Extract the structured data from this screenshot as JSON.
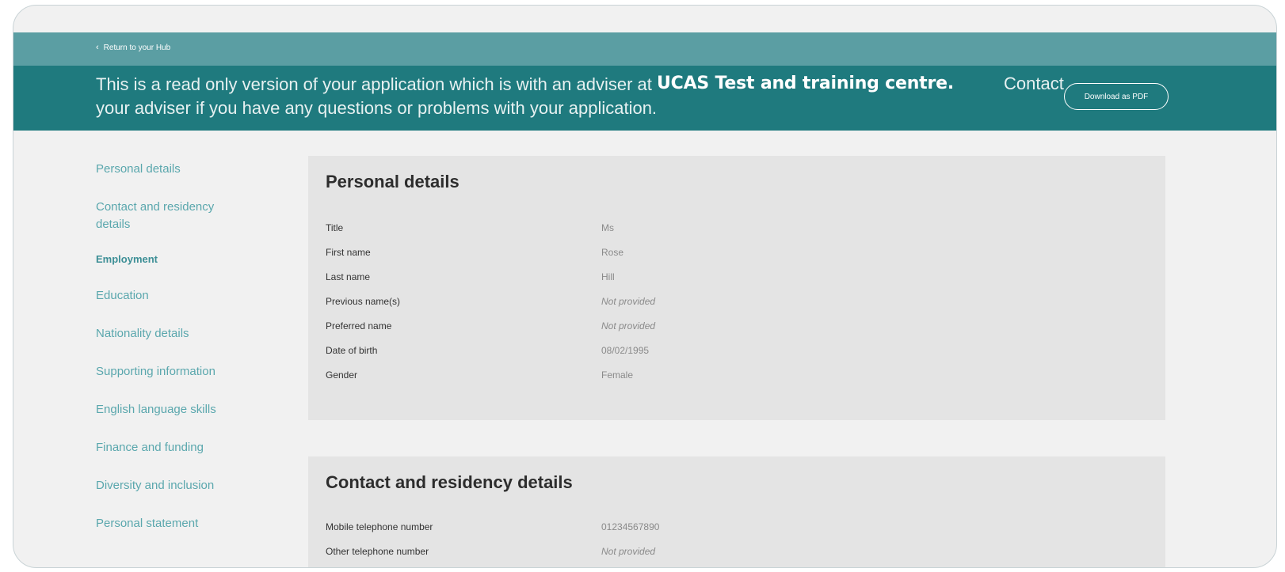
{
  "topbar": {
    "back_label": "Return to your Hub"
  },
  "banner": {
    "message_line1": "This is a read only version of your application which is with an adviser at",
    "message_line2": "your adviser if you have any questions or problems with your application.",
    "centre_name": "UCAS Test and training centre.",
    "contact_label": "Contact",
    "download_button": "Download as PDF"
  },
  "sidebar": {
    "items": [
      "Personal details",
      "Contact and residency details",
      "Employment",
      "Education",
      "Nationality details",
      "Supporting information",
      "English language skills",
      "Finance and funding",
      "Diversity and inclusion",
      "Personal statement"
    ],
    "active_index": 2
  },
  "personal_details": {
    "title": "Personal details",
    "rows": [
      {
        "label": "Title",
        "value": "Ms"
      },
      {
        "label": "First name",
        "value": "Rose"
      },
      {
        "label": "Last name",
        "value": "Hill"
      },
      {
        "label": "Previous name(s)",
        "value": "Not provided"
      },
      {
        "label": "Preferred name",
        "value": "Not provided"
      },
      {
        "label": "Date of birth",
        "value": "08/02/1995"
      },
      {
        "label": "Gender",
        "value": "Female"
      }
    ]
  },
  "contact_details": {
    "title": "Contact and residency details",
    "rows": [
      {
        "label": "Mobile telephone number",
        "value": "01234567890"
      },
      {
        "label": "Other telephone number",
        "value": "Not provided"
      }
    ]
  },
  "colors": {
    "topbar": "#5b9ea3",
    "banner": "#1f7a7e",
    "nav_link": "#5aa7ad",
    "card_bg": "#e4e4e4"
  }
}
